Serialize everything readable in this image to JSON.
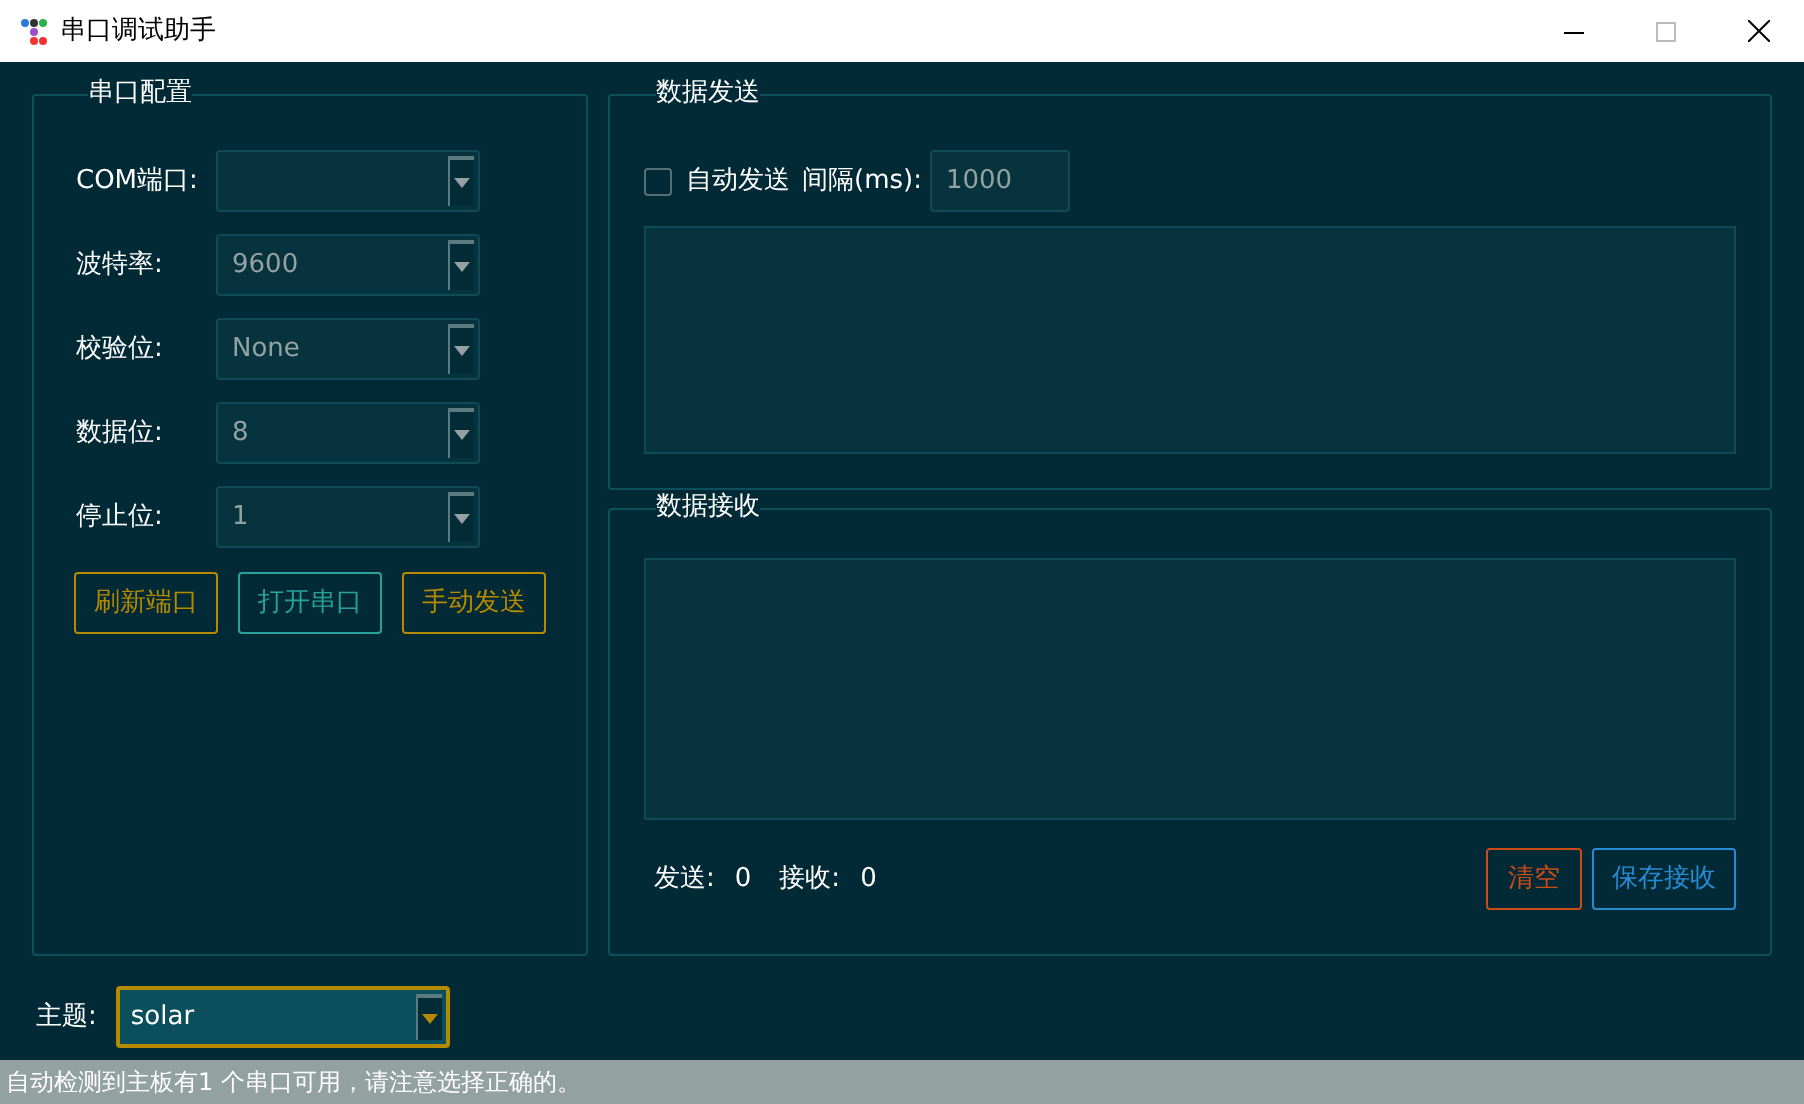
{
  "window": {
    "title": "串口调试助手"
  },
  "config": {
    "title": "串口配置",
    "fields": [
      {
        "label": "COM端口:"
      },
      {
        "label": "波特率:",
        "value": "9600"
      },
      {
        "label": "校验位:",
        "value": "None"
      },
      {
        "label": "数据位:",
        "value": "8"
      },
      {
        "label": "停止位:",
        "value": "1"
      }
    ],
    "buttons": [
      {
        "label": "刷新端口",
        "color": "#b58900"
      },
      {
        "label": "打开串口",
        "color": "#2aa198"
      },
      {
        "label": "手动发送",
        "color": "#b58900"
      }
    ]
  },
  "send": {
    "title": "数据发送",
    "auto_send": {
      "label": "自动发送",
      "checked": false
    },
    "interval": {
      "label": "间隔(ms):",
      "value": "1000"
    }
  },
  "receive": {
    "title": "数据接收",
    "counters": [
      {
        "label": "发送:",
        "value": "0"
      },
      {
        "label": "接收:",
        "value": "0"
      }
    ],
    "buttons": [
      {
        "label": "清空",
        "color": "#cb4b16"
      },
      {
        "label": "保存接收",
        "color": "#268bd2"
      }
    ]
  },
  "theme": {
    "label": "主题:",
    "value": "solar"
  },
  "status_bar": "自动检测到主板有1 个串口可用，请注意选择正确的。"
}
